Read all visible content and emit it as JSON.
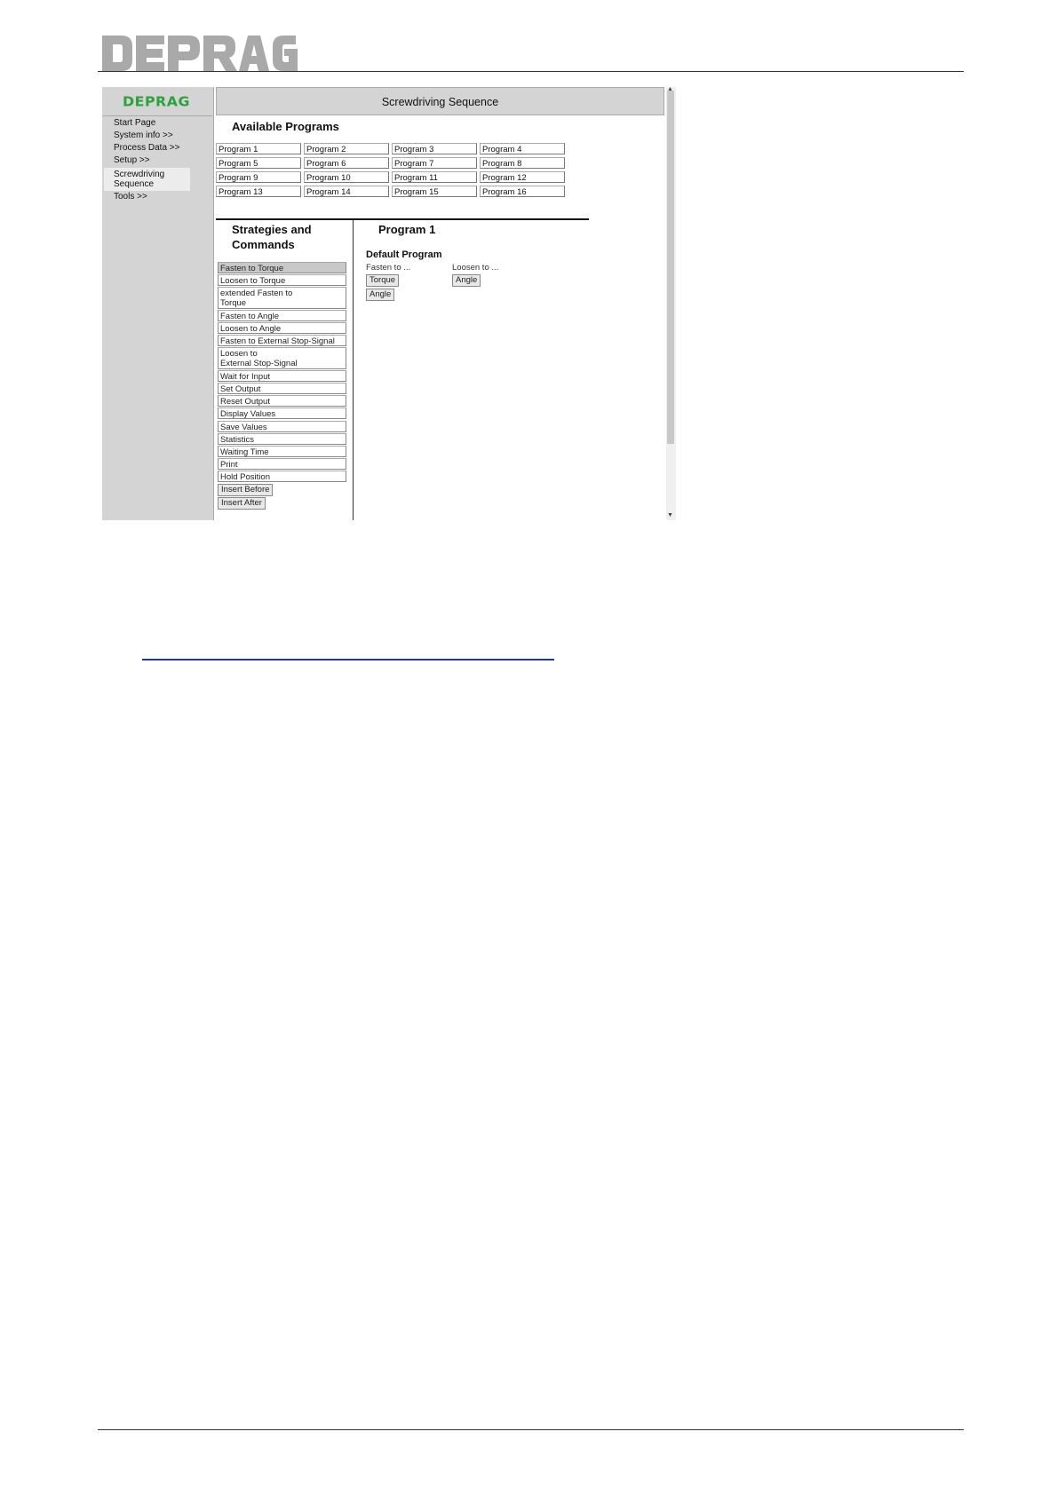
{
  "document": {
    "brand": "DEPRAG"
  },
  "screenshot": {
    "brand": "DEPRAG",
    "window_title": "Screwdriving Sequence",
    "nav": [
      {
        "label": "Start Page"
      },
      {
        "label": "System info >>"
      },
      {
        "label": "Process Data >>"
      },
      {
        "label": "Setup >>"
      },
      {
        "label": "Screwdriving"
      },
      {
        "label": "Sequence"
      },
      {
        "label": "Tools >>"
      }
    ],
    "available_programs_title": "Available Programs",
    "programs": [
      "Program 1",
      "Program 2",
      "Program 3",
      "Program 4",
      "Program 5",
      "Program 6",
      "Program 7",
      "Program 8",
      "Program 9",
      "Program 10",
      "Program 11",
      "Program 12",
      "Program 13",
      "Program 14",
      "Program 15",
      "Program 16"
    ],
    "strategies_title_line1": "Strategies and",
    "strategies_title_line2": "Commands",
    "commands": [
      "Fasten to Torque",
      "Loosen to Torque",
      "extended Fasten to",
      "Torque",
      "Fasten to Angle",
      "Loosen to Angle",
      "Fasten to External Stop-Signal",
      "Loosen to",
      "External Stop-Signal",
      "Wait for Input",
      "Set Output",
      "Reset Output",
      "Display Values",
      "Save Values",
      "Statistics",
      "Waiting Time",
      "Print",
      "Hold Position"
    ],
    "insert_before": "Insert Before",
    "insert_after": "Insert After",
    "program_title": "Program 1",
    "default_program": "Default Program",
    "fasten_to": "Fasten to ...",
    "loosen_to": "Loosen to ...",
    "torque_btn": "Torque",
    "angle_btn_fasten": "Angle",
    "angle_btn_loosen": "Angle"
  }
}
